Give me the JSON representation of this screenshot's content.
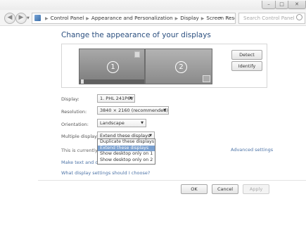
{
  "window": {
    "min_label": "–",
    "max_label": "□",
    "close_label": "✕"
  },
  "nav": {
    "back_label": "◀",
    "forward_label": "▶",
    "dropdown_label": "▼"
  },
  "address": {
    "crumbs": [
      "Control Panel",
      "Appearance and Personalization",
      "Display",
      "Screen Resolution"
    ],
    "dropdown_label": "▾",
    "refresh_label": "↻"
  },
  "search": {
    "placeholder": "Search Control Panel"
  },
  "page": {
    "heading": "Change the appearance of your displays"
  },
  "monitors": {
    "one": "1",
    "two": "2"
  },
  "buttons": {
    "detect": "Detect",
    "identify": "Identify",
    "ok": "OK",
    "cancel": "Cancel",
    "apply": "Apply"
  },
  "settings": {
    "display_label": "Display:",
    "display_value": "1. PHL 241P6V",
    "resolution_label": "Resolution:",
    "resolution_value": "3840 × 2160 (recommended)",
    "orientation_label": "Orientation:",
    "orientation_value": "Landscape",
    "multiple_label": "Multiple displays:",
    "multiple_value": "Extend these displays"
  },
  "dropdown_options": [
    "Duplicate these displays",
    "Extend these displays",
    "Show desktop only on 1",
    "Show desktop only on 2"
  ],
  "dropdown_selected_index": 1,
  "info": {
    "current_text": "This is currently your",
    "advanced": "Advanced settings",
    "make_text": "Make text and other",
    "what_settings": "What display settings should I choose?"
  }
}
